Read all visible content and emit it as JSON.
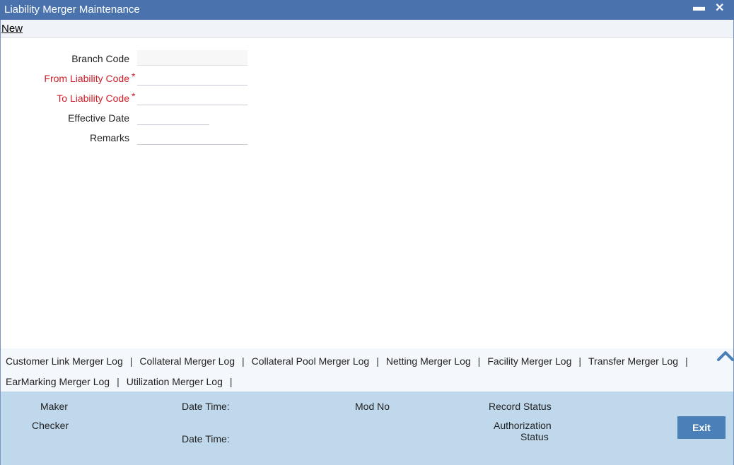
{
  "window": {
    "title": "Liability Merger Maintenance",
    "minimize_glyph": "▬",
    "close_glyph": "✕"
  },
  "toolbar": {
    "new_label": "New"
  },
  "form": {
    "branch_code": {
      "label": "Branch Code",
      "value": ""
    },
    "from_liability_code": {
      "label": "From Liability Code",
      "required_mark": "*",
      "value": ""
    },
    "to_liability_code": {
      "label": "To Liability Code",
      "required_mark": "*",
      "value": ""
    },
    "effective_date": {
      "label": "Effective Date",
      "value": ""
    },
    "remarks": {
      "label": "Remarks",
      "value": ""
    }
  },
  "tabs": {
    "separator": "|",
    "row1": [
      "Customer Link Merger Log",
      "Collateral Merger Log",
      "Collateral Pool Merger Log",
      "Netting Merger Log",
      "Facility Merger Log",
      "Transfer Merger Log"
    ],
    "row2": [
      "EarMarking Merger Log",
      "Utilization Merger Log"
    ],
    "collapse_icon": "chevron-up-icon"
  },
  "footer": {
    "maker_label": "Maker",
    "checker_label": "Checker",
    "date_time_label_1": "Date Time:",
    "date_time_label_2": "Date Time:",
    "mod_no_label": "Mod No",
    "record_status_label": "Record Status",
    "authorization_label_line1": "Authorization",
    "authorization_label_line2": "Status",
    "exit_label": "Exit"
  },
  "colors": {
    "titlebar": "#4a72ad",
    "footer": "#c0d8ec",
    "required_label": "#cc1e2a",
    "exit_button": "#4a80b8"
  }
}
